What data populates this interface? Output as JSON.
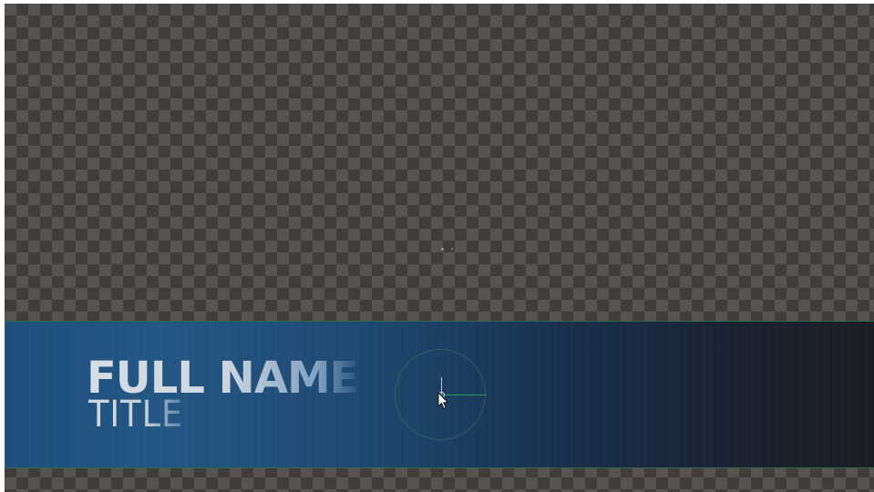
{
  "viewer": {
    "background_pattern": "transparency-checkerboard",
    "checker_light": "#575350",
    "checker_dark": "#403d3b"
  },
  "lower_third": {
    "full_name": "FULL NAME",
    "title": "TITLE",
    "bar_color_start": "#245684",
    "bar_color_end": "#1b1d24",
    "border_color": "#2f6a4a"
  },
  "transform_widget": {
    "icon": "transform-gizmo-icon",
    "x_axis_color": "#2f9a5a"
  },
  "cursor": {
    "icon": "arrow-cursor-icon"
  }
}
